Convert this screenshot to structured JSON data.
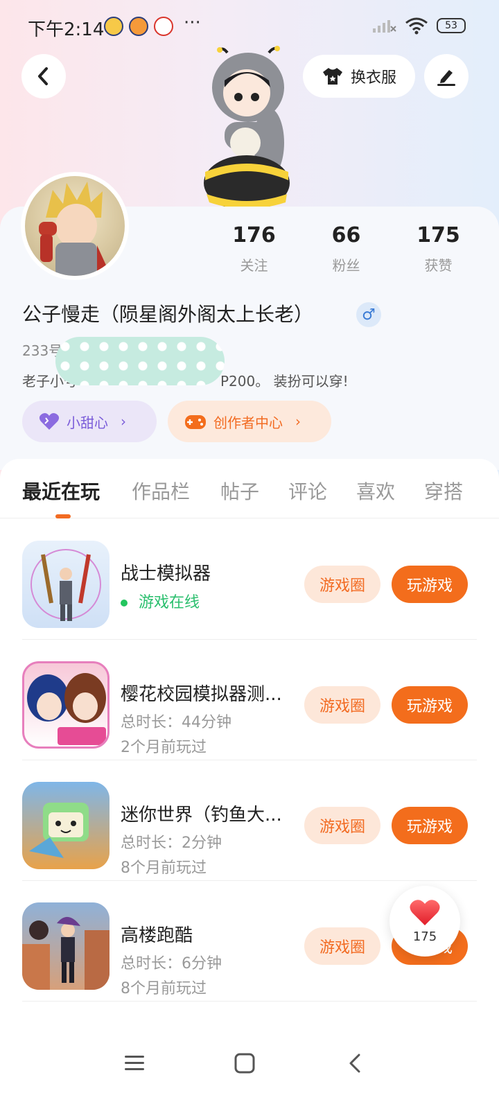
{
  "status_bar": {
    "time": "下午2:14",
    "more": "···",
    "battery": "53"
  },
  "header": {
    "dress_label": "换衣服"
  },
  "profile": {
    "username": "公子慢走（陨星阁外阁太上长老）",
    "gender_icon": "♂",
    "uid_prefix": "233号",
    "bio_prefix": "老子小号",
    "bio_suffix": "P200。 装扮可以穿!",
    "stats": [
      {
        "value": "176",
        "label": "关注"
      },
      {
        "value": "66",
        "label": "粉丝"
      },
      {
        "value": "175",
        "label": "获赞"
      }
    ],
    "chips": {
      "sweet": "小甜心",
      "creator": "创作者中心"
    }
  },
  "tabs": [
    "最近在玩",
    "作品栏",
    "帖子",
    "评论",
    "喜欢",
    "穿搭"
  ],
  "games": [
    {
      "name": "战士模拟器",
      "line1": "游戏在线",
      "line2": "",
      "online": true
    },
    {
      "name": "樱花校园模拟器测...",
      "line1": "总时长：44分钟",
      "line2": "2个月前玩过",
      "online": false
    },
    {
      "name": "迷你世界（钓鱼大...",
      "line1": "总时长：2分钟",
      "line2": "8个月前玩过",
      "online": false
    },
    {
      "name": "高楼跑酷",
      "line1": "总时长：6分钟",
      "line2": "8个月前玩过",
      "online": false
    }
  ],
  "game_buttons": {
    "circle": "游戏圈",
    "play": "玩游戏"
  },
  "like_float": {
    "count": "175"
  },
  "colors": {
    "accent": "#f36d1c",
    "online": "#2bbf6e",
    "sweet": "#7a5cd9"
  }
}
